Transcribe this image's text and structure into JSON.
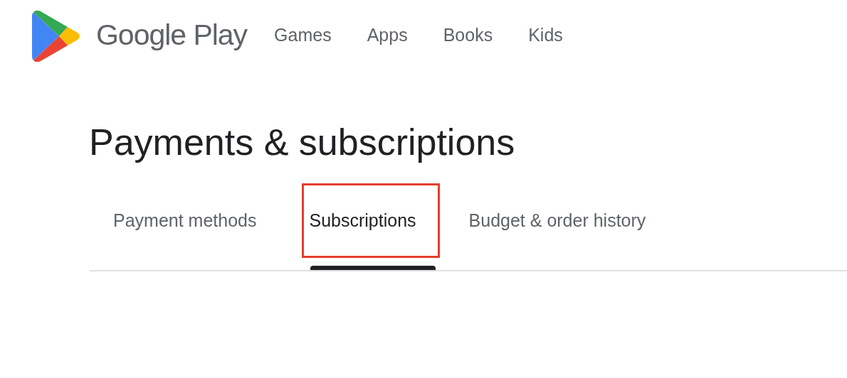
{
  "brand": {
    "name": "Google Play"
  },
  "nav": [
    {
      "label": "Games"
    },
    {
      "label": "Apps"
    },
    {
      "label": "Books"
    },
    {
      "label": "Kids"
    }
  ],
  "title": "Payments & subscriptions",
  "tabs": [
    {
      "label": "Payment methods",
      "selected": false,
      "highlighted": false
    },
    {
      "label": "Subscriptions",
      "selected": true,
      "highlighted": true
    },
    {
      "label": "Budget & order history",
      "selected": false,
      "highlighted": false
    }
  ]
}
